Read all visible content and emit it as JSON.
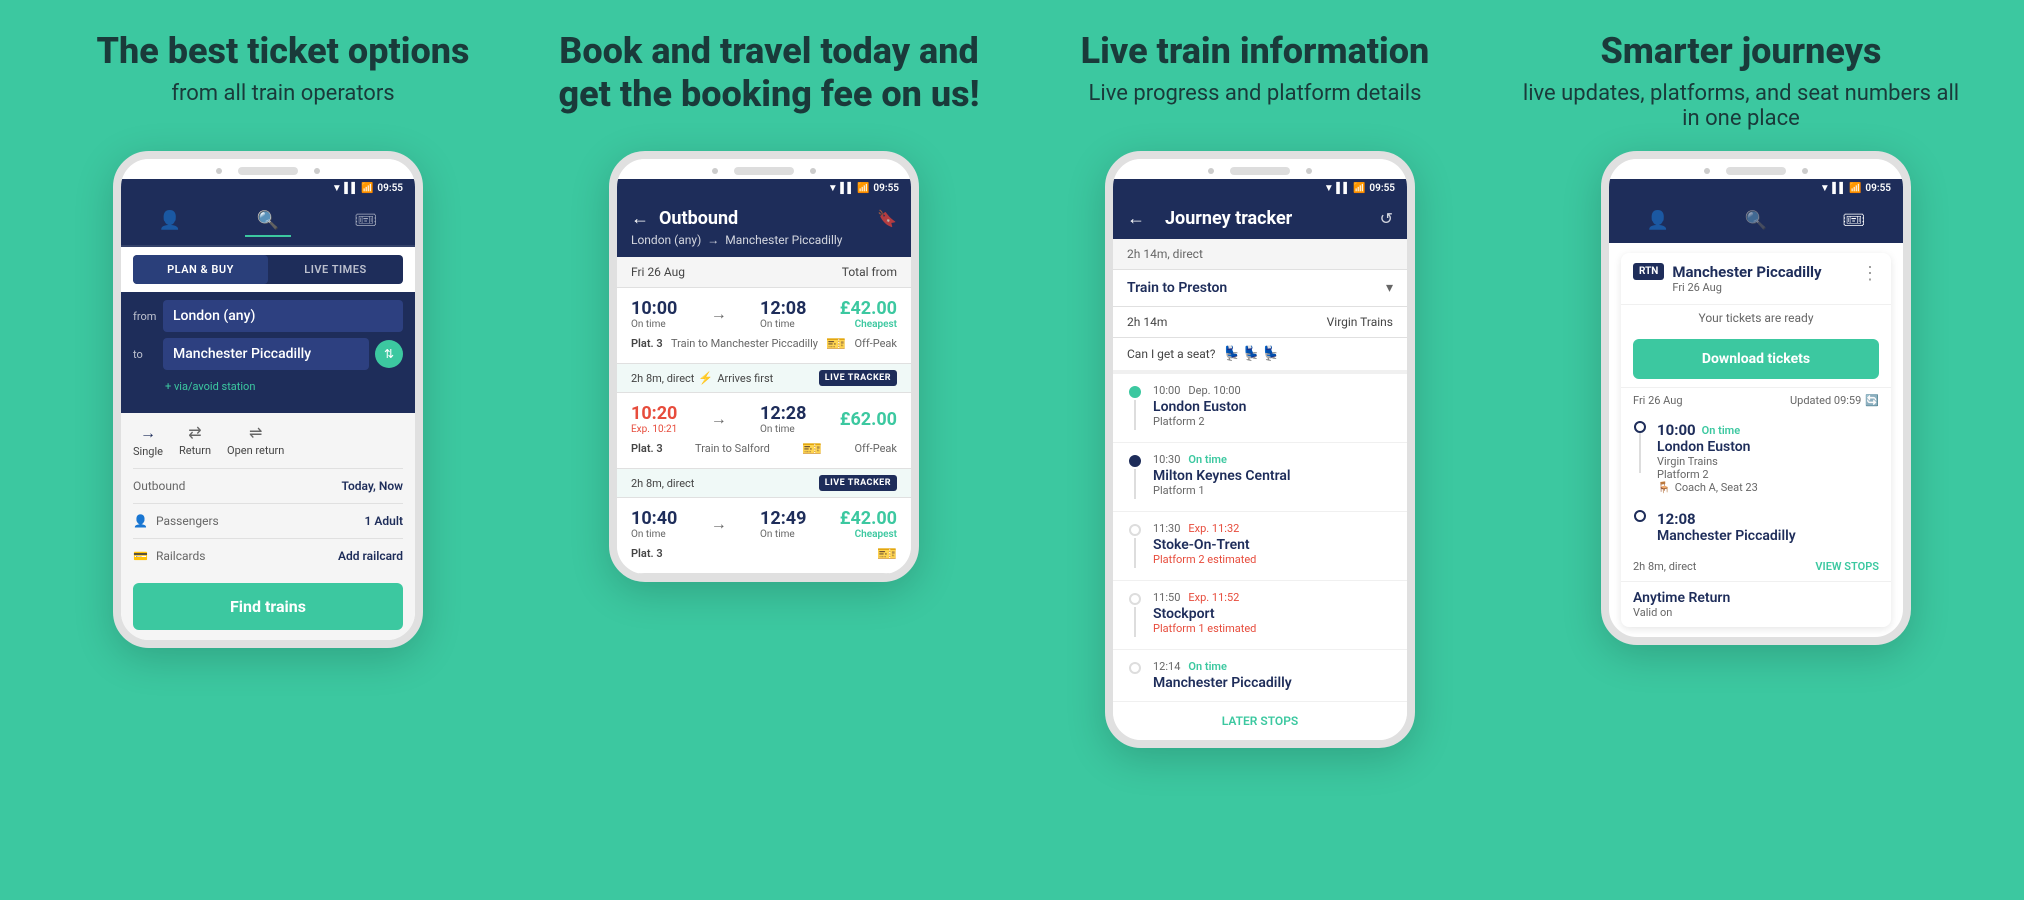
{
  "bg_color": "#3cc8a0",
  "columns": [
    {
      "id": "phone1",
      "headline": "The best ticket options",
      "subhead": "from all train operators"
    },
    {
      "id": "phone2",
      "headline": "Book and travel today and get the booking fee on us!",
      "subhead": ""
    },
    {
      "id": "phone3",
      "headline": "Live train information",
      "subhead": "Live progress and platform details"
    },
    {
      "id": "phone4",
      "headline": "Smarter journeys",
      "subhead": "live updates, platforms, and seat numbers all in one place"
    }
  ],
  "phone1": {
    "time": "09:55",
    "tab_active": "PLAN & BUY",
    "tab_inactive": "LIVE TIMES",
    "from_label": "from",
    "from_value": "London (any)",
    "to_label": "to",
    "to_value": "Manchester Piccadilly",
    "via_text": "+ via/avoid station",
    "journey_types": [
      "Single",
      "Return",
      "Open return"
    ],
    "outbound_label": "Outbound",
    "outbound_value": "Today, Now",
    "passengers_label": "Passengers",
    "passengers_value": "1 Adult",
    "railcards_label": "Railcards",
    "railcards_value": "Add railcard",
    "find_trains_btn": "Find trains"
  },
  "phone2": {
    "time": "09:55",
    "header_title": "Outbound",
    "route_from": "London (any)",
    "route_to": "Manchester Piccadilly",
    "date_label": "Fri 26 Aug",
    "total_from_label": "Total from",
    "tickets": [
      {
        "depart": "10:00",
        "depart_status": "On time",
        "arrive": "12:08",
        "arrive_status": "On time",
        "price": "£42.00",
        "price_label": "Cheapest",
        "platform": "Plat. 3",
        "train_to": "Train to Manchester Piccadilly",
        "ticket_type": "Off-Peak",
        "arrives_first": true,
        "live_tracker": true,
        "duration": "2h 8m, direct"
      },
      {
        "depart": "10:20",
        "depart_status": "Exp. 10:21",
        "depart_red": true,
        "arrive": "12:28",
        "arrive_status": "On time",
        "price": "£62.00",
        "price_label": "",
        "platform": "Plat. 3",
        "train_to": "Train to Salford",
        "ticket_type": "Off-Peak",
        "arrives_first": false,
        "live_tracker": true,
        "duration": "2h 8m, direct"
      },
      {
        "depart": "10:40",
        "depart_status": "On time",
        "arrive": "12:49",
        "arrive_status": "On time",
        "price": "£42.00",
        "price_label": "Cheapest",
        "platform": "Plat. 3",
        "train_to": "",
        "ticket_type": "",
        "arrives_first": false,
        "live_tracker": false,
        "duration": ""
      }
    ]
  },
  "phone3": {
    "time": "09:55",
    "header_title": "Journey tracker",
    "journey_summary": "2h 14m, direct",
    "train_name": "Train to Preston",
    "duration": "2h 14m",
    "operator": "Virgin Trains",
    "seat_question": "Can I get a seat?",
    "stops": [
      {
        "time": "10:00",
        "dep_time": "Dep. 10:00",
        "name": "London Euston",
        "platform": "Platform 2",
        "status": "passed",
        "exp_time": null
      },
      {
        "time": "10:30",
        "dep_time": null,
        "name": "Milton Keynes Central",
        "platform": "Platform 1",
        "status": "current",
        "exp_time": null,
        "on_time": "On time"
      },
      {
        "time": "11:30",
        "dep_time": null,
        "name": "Stoke-On-Trent",
        "platform": "Platform 2 estimated",
        "status": "upcoming",
        "exp_time": "Exp. 11:32"
      },
      {
        "time": "11:50",
        "dep_time": null,
        "name": "Stockport",
        "platform": "Platform 1 estimated",
        "status": "upcoming",
        "exp_time": "Exp. 11:52"
      },
      {
        "time": "12:14",
        "dep_time": null,
        "name": "Manchester Piccadilly",
        "platform": "",
        "status": "upcoming",
        "exp_time": null,
        "on_time": "On time"
      }
    ],
    "later_stops": "LATER STOPS"
  },
  "phone4": {
    "time": "09:55",
    "rtn_badge": "RTN",
    "dest_name": "Manchester Piccadilly",
    "dest_date": "Fri 26 Aug",
    "tickets_ready": "Your tickets are ready",
    "download_btn": "Download tickets",
    "date_label": "Fri 26 Aug",
    "updated": "Updated 09:59",
    "stop1": {
      "time": "10:00",
      "status": "On time",
      "station": "London Euston",
      "operator": "Virgin Trains",
      "platform": "Platform 2",
      "coach": "Coach A, Seat 23"
    },
    "stop2": {
      "time": "12:08",
      "station": "Manchester Piccadilly"
    },
    "duration": "2h 8m, direct",
    "view_stops": "VIEW STOPS",
    "ticket_type": "Anytime Return",
    "valid_on": "Valid on"
  }
}
